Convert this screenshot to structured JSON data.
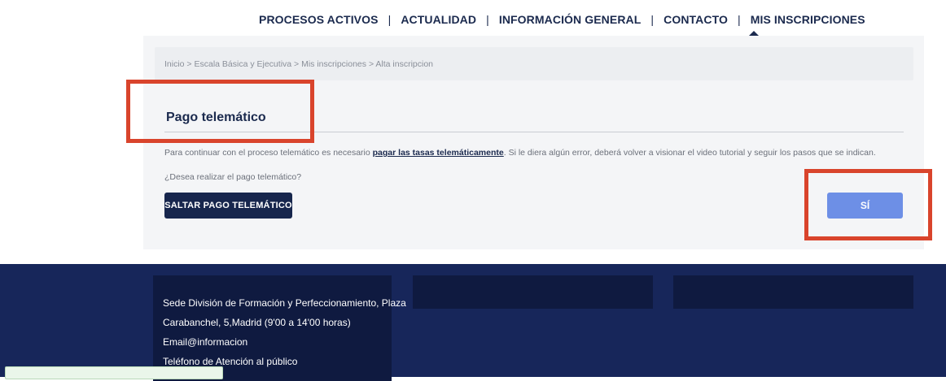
{
  "nav": {
    "items": [
      {
        "label": "PROCESOS ACTIVOS"
      },
      {
        "label": "ACTUALIDAD"
      },
      {
        "label": "INFORMACIÓN GENERAL"
      },
      {
        "label": "CONTACTO"
      },
      {
        "label": "MIS INSCRIPCIONES"
      }
    ],
    "separator": "|",
    "active": "MIS INSCRIPCIONES"
  },
  "breadcrumb": "Inicio > Escala Básica y Ejecutiva > Mis inscripciones > Alta inscripcion",
  "section": {
    "title": "Pago telemático",
    "info_before": "Para continuar con el proceso telemático es necesario ",
    "info_link": "pagar las tasas telemáticamente",
    "info_after": ". Si le diera algún error, deberá volver a visionar el video tutorial y seguir los pasos que se indican.",
    "question": "¿Desea realizar el pago telemático?"
  },
  "buttons": {
    "skip_label": "SALTAR PAGO TELEMÁTICO",
    "yes_label": "SÍ"
  },
  "footer": {
    "address_line_1": "Sede División de Formación y Perfeccionamiento, Plaza",
    "address_line_2": "Carabanchel, 5,Madrid (9'00 a 14'00 horas)",
    "email": "Email@informacion",
    "phone_label": "Teléfono de Atención al público"
  },
  "colors": {
    "brand_navy": "#1b2a4e",
    "button_dark": "#17264d",
    "button_accent": "#6d8fe6",
    "footer_bg": "#17265a",
    "annotation_red": "#d9442c"
  },
  "icons": {
    "active_indicator": "caret-up-icon"
  }
}
